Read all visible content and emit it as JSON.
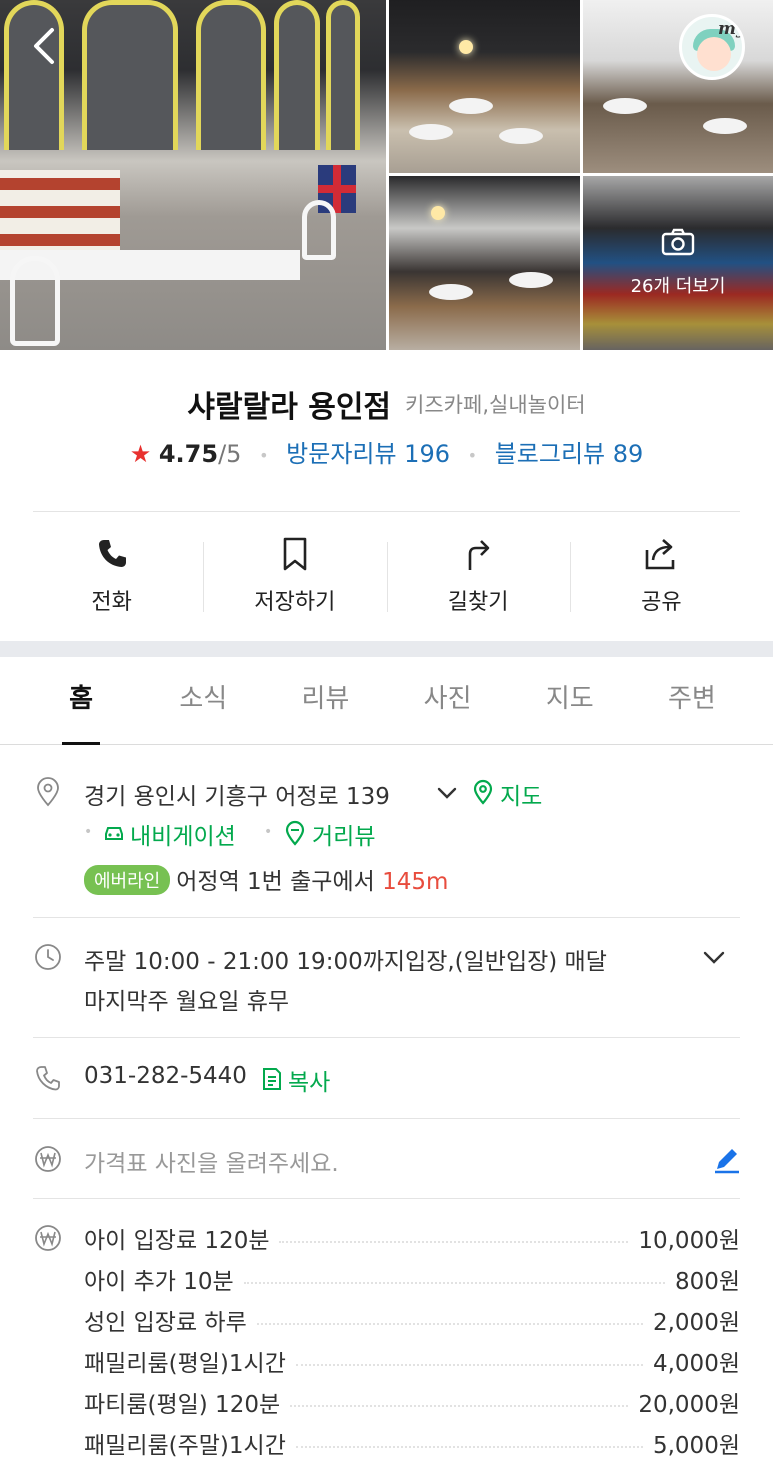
{
  "gallery": {
    "more_photos_label": "26개 더보기",
    "my_badge": "my"
  },
  "place": {
    "name": "샤랄랄라 용인점",
    "category": "키즈카페,실내놀이터",
    "rating": "4.75",
    "rating_max": "/5",
    "visitor_reviews": "방문자리뷰 196",
    "blog_reviews": "블로그리뷰 89"
  },
  "actions": [
    {
      "label": "전화",
      "icon": "phone-icon"
    },
    {
      "label": "저장하기",
      "icon": "bookmark-icon"
    },
    {
      "label": "길찾기",
      "icon": "directions-icon"
    },
    {
      "label": "공유",
      "icon": "share-icon"
    }
  ],
  "tabs": [
    "홈",
    "소식",
    "리뷰",
    "사진",
    "지도",
    "주변"
  ],
  "info": {
    "address": "경기 용인시 기흥구 어정로 139",
    "map_link": "지도",
    "navigation_link": "내비게이션",
    "streetview_link": "거리뷰",
    "subway_line": "에버라인",
    "subway_station": "어정역 1번 출구에서",
    "subway_distance": "145m",
    "hours_line1": "주말 10:00 - 21:00 19:00까지입장,(일반입장) 매달",
    "hours_line2": "마지막주 월요일 휴무",
    "phone": "031-282-5440",
    "copy_label": "복사",
    "price_photo_prompt": "가격표 사진을 올려주세요."
  },
  "prices": [
    {
      "name": "아이 입장료 120분",
      "price": "10,000원"
    },
    {
      "name": "아이 추가 10분",
      "price": "800원"
    },
    {
      "name": "성인 입장료 하루",
      "price": "2,000원"
    },
    {
      "name": "패밀리룸(평일)1시간",
      "price": "4,000원"
    },
    {
      "name": "파티룸(평일) 120분",
      "price": "20,000원"
    },
    {
      "name": "패밀리룸(주말)1시간",
      "price": "5,000원"
    }
  ],
  "colors": {
    "accent_green": "#03a94d",
    "link_blue": "#1c6fb6",
    "star_red": "#e8312f",
    "distance_red": "#e84c3d",
    "line_badge": "#77c152",
    "edit_blue": "#1a73e8"
  }
}
